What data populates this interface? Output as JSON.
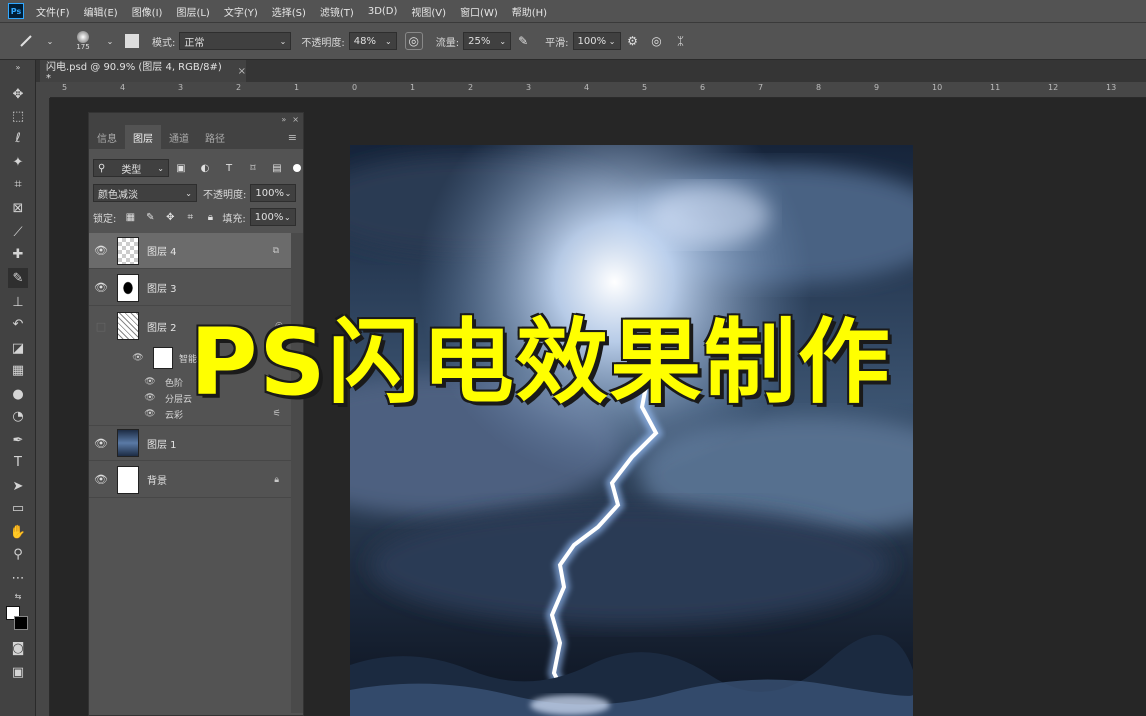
{
  "menu": [
    "文件(F)",
    "编辑(E)",
    "图像(I)",
    "图层(L)",
    "文字(Y)",
    "选择(S)",
    "滤镜(T)",
    "3D(D)",
    "视图(V)",
    "窗口(W)",
    "帮助(H)"
  ],
  "app_logo": "Ps",
  "options": {
    "brush_size": "175",
    "mode_label": "模式:",
    "mode_value": "正常",
    "opacity_label": "不透明度:",
    "opacity_value": "48%",
    "flow_label": "流量:",
    "flow_value": "25%",
    "smooth_label": "平滑:",
    "smooth_value": "100%"
  },
  "document_tab": {
    "title": "闪电.psd @ 90.9% (图层 4, RGB/8#) *",
    "close": "×"
  },
  "ruler_labels": [
    "5",
    "4",
    "3",
    "2",
    "1",
    "0",
    "1",
    "2",
    "3",
    "4",
    "5",
    "6",
    "7",
    "8",
    "9",
    "10",
    "11",
    "12",
    "13"
  ],
  "layers_panel": {
    "tabs": [
      "信息",
      "图层",
      "通道",
      "路径"
    ],
    "filter_label": "类型",
    "blend_mode": "颜色减淡",
    "opacity_label": "不透明度:",
    "opacity_value": "100%",
    "lock_label": "锁定:",
    "fill_label": "填充:",
    "fill_value": "100%",
    "layers": [
      {
        "name": "图层 4",
        "visible": true
      },
      {
        "name": "图层 3",
        "visible": true
      },
      {
        "name": "图层 2",
        "visible": false
      },
      {
        "name": "智能",
        "visible": true
      },
      {
        "name": "色阶",
        "visible": true
      },
      {
        "name": "分层云",
        "visible": true
      },
      {
        "name": "云彩",
        "visible": true
      },
      {
        "name": "图层 1",
        "visible": true
      },
      {
        "name": "背景",
        "visible": true
      }
    ]
  },
  "overlay_title": "PS闪电效果制作",
  "colors": {
    "title": "#ffff00",
    "ui_bg": "#535353",
    "canvas_bg": "#262626"
  }
}
